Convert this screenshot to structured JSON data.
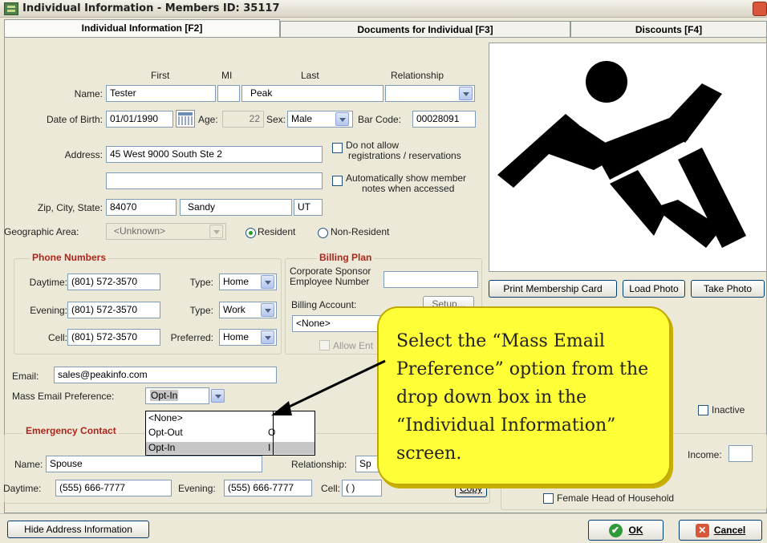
{
  "window": {
    "title": "Individual Information - Members ID: 35117"
  },
  "tabs": [
    {
      "label": "Individual Information [F2]"
    },
    {
      "label": "Documents for Individual [F3]"
    },
    {
      "label": "Discounts [F4]"
    }
  ],
  "name_section": {
    "col_first": "First",
    "col_mi": "MI",
    "col_last": "Last",
    "col_relationship": "Relationship",
    "name_label": "Name:",
    "first": "Tester",
    "mi": "",
    "last": "Peak",
    "relationship": "",
    "dob_label": "Date of Birth:",
    "dob": "01/01/1990",
    "age_label": "Age:",
    "age": "22",
    "sex_label": "Sex:",
    "sex": "Male",
    "barcode_label": "Bar Code:",
    "barcode": "00028091",
    "address_label": "Address:",
    "address1": "45 West 9000 South Ste 2",
    "address2": "",
    "no_reg_label_1": "Do not allow",
    "no_reg_label_2": "registrations / reservations",
    "show_notes_label_1": "Automatically show member",
    "show_notes_label_2": "notes when accessed",
    "zip_label": "Zip, City, State:",
    "zip": "84070",
    "city": "Sandy",
    "state": "UT",
    "geo_label": "Geographic Area:",
    "geo": "<Unknown>",
    "resident_label": "Resident",
    "nonresident_label": "Non-Resident"
  },
  "phones": {
    "title": "Phone Numbers",
    "daytime_label": "Daytime:",
    "daytime": "(801) 572-3570",
    "daytime_type": "Home",
    "evening_label": "Evening:",
    "evening": "(801) 572-3570",
    "evening_type": "Work",
    "cell_label": "Cell:",
    "cell": "(801) 572-3570",
    "cell_type": "Home",
    "type_label": "Type:",
    "preferred_label": "Preferred:"
  },
  "billing": {
    "title": "Billing Plan",
    "corp_label_1": "Corporate Sponsor",
    "corp_label_2": "Employee Number",
    "account_label": "Billing Account:",
    "setup": "Setup...",
    "account": "<None>",
    "allow_label": "Allow Ent"
  },
  "email": {
    "email_label": "Email:",
    "email": "sales@peakinfo.com",
    "pref_label": "Mass Email Preference:",
    "pref": "Opt-In",
    "options": [
      {
        "label": "<None>",
        "code": ""
      },
      {
        "label": "Opt-Out",
        "code": "O"
      },
      {
        "label": "Opt-In",
        "code": "I"
      }
    ]
  },
  "emergency": {
    "title": "Emergency Contact",
    "name_label": "Name:",
    "name": "Spouse",
    "relationship_label": "Relationship:",
    "relationship": "Sp",
    "daytime_label": "Daytime:",
    "daytime": "(555) 666-7777",
    "evening_label": "Evening:",
    "evening": "(555) 666-7777",
    "cell_label": "Cell:",
    "cell": "(  )",
    "copy_btn": "Copy"
  },
  "photo_buttons": {
    "print": "Print Membership Card",
    "load": "Load Photo",
    "take": "Take Photo"
  },
  "inactive_label": "Inactive",
  "income_label": "Income:",
  "female_head_label": "Female Head of Household",
  "callout": {
    "text": "Select the “Mass Email Preference” option from the drop down box in the “Individual Information” screen."
  },
  "bottom": {
    "hide_address": "Hide Address Information",
    "ok": "OK",
    "cancel": "Cancel"
  }
}
